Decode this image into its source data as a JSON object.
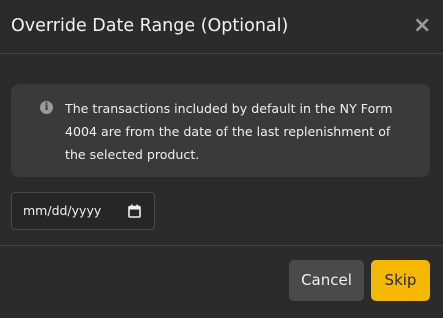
{
  "modal": {
    "title": "Override Date Range (Optional)",
    "close_glyph": "×"
  },
  "info": {
    "icon": "info-icon",
    "icon_glyph": "i",
    "text": "The transactions included by default in the NY Form 4004 are from the date of the last replenishment of the selected product."
  },
  "date_input": {
    "placeholder": "mm/dd/yyyy",
    "icon": "calendar-icon"
  },
  "footer": {
    "cancel_label": "Cancel",
    "skip_label": "Skip"
  },
  "colors": {
    "background": "#2b2b2b",
    "info_box": "#3a3a3a",
    "primary_button": "#f5b800",
    "secondary_button": "#4a4a4a"
  }
}
